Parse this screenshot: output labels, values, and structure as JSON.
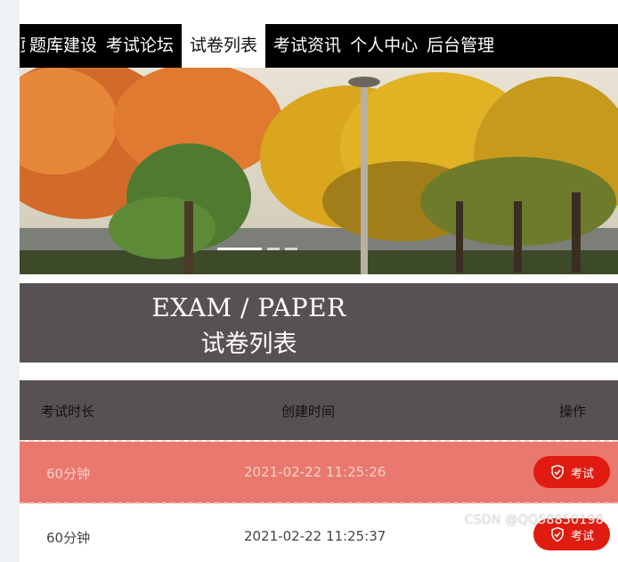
{
  "nav": {
    "items": [
      {
        "label": "页",
        "partial": true
      },
      {
        "label": "题库建设"
      },
      {
        "label": "考试论坛"
      },
      {
        "label": "试卷列表",
        "active": true
      },
      {
        "label": "考试资讯"
      },
      {
        "label": "个人中心"
      },
      {
        "label": "后台管理"
      }
    ]
  },
  "section": {
    "title_en": "EXAM / PAPER",
    "title_cn": "试卷列表"
  },
  "table": {
    "headers": [
      "考试时长",
      "创建时间",
      "操作"
    ],
    "rows": [
      {
        "duration": "60分钟",
        "created": "2021-02-22 11:25:26",
        "action": "考试",
        "highlight": true
      },
      {
        "duration": "60分钟",
        "created": "2021-02-22 11:25:37",
        "action": "考试",
        "highlight": false
      }
    ]
  },
  "watermark": "CSDN @QQ58850198",
  "colors": {
    "nav_bg": "#000000",
    "band_bg": "#575251",
    "highlight_row": "#e9786f",
    "button": "#e01c10"
  }
}
